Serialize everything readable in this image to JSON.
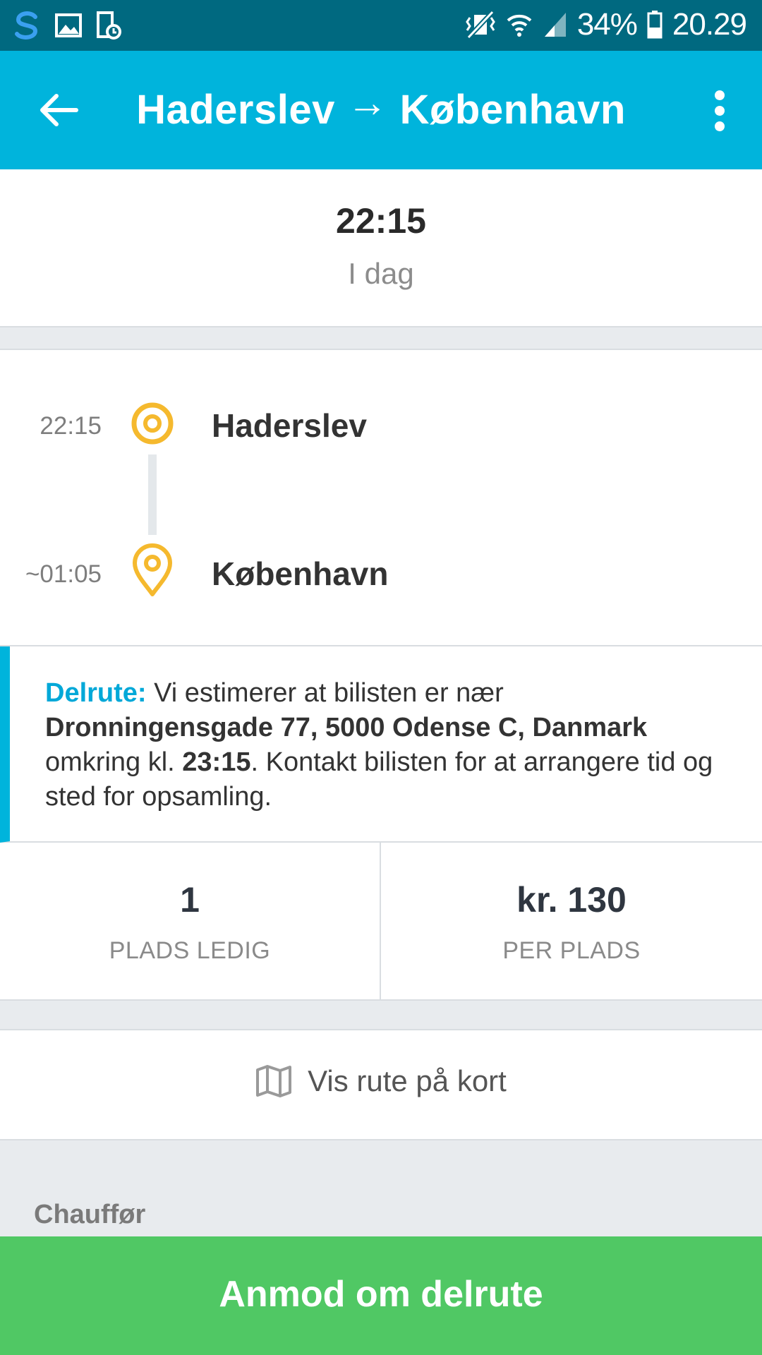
{
  "status_bar": {
    "battery": "34%",
    "time": "20.29",
    "icons": [
      "skype-icon",
      "image-icon",
      "screen-timer-icon",
      "vibrate-mute-icon",
      "wifi-icon",
      "signal-icon",
      "battery-icon"
    ]
  },
  "appbar": {
    "from": "Haderslev",
    "arrow": "→",
    "to": "København",
    "color": "#00b4dc"
  },
  "departure": {
    "time": "22:15",
    "day": "I dag"
  },
  "itinerary": {
    "stops": [
      {
        "time": "22:15",
        "name": "Haderslev"
      },
      {
        "time": "~01:05",
        "name": "København"
      }
    ],
    "pin_color": "#f5b92e"
  },
  "note": {
    "label": "Delrute:",
    "text1": " Vi estimerer at bilisten er nær ",
    "address": "Dronningensgade 77, 5000 Odense C, Danmark",
    "text2": " omkring kl. ",
    "time": "23:15",
    "text3": ". Kontakt bilisten for at arrangere tid og sted for opsamling."
  },
  "stats": {
    "seats_value": "1",
    "seats_label": "PLADS LEDIG",
    "price_value": "kr. 130",
    "price_label": "PER PLADS"
  },
  "map_button": {
    "label": "Vis rute på kort"
  },
  "driver_section": {
    "title": "Chauffør"
  },
  "cta": {
    "label": "Anmod om delrute",
    "color": "#50c864"
  }
}
